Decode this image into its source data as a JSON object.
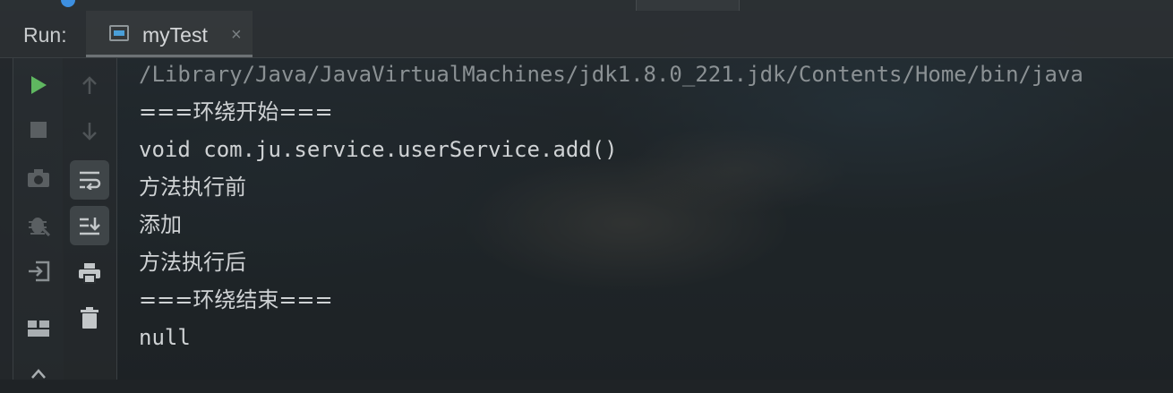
{
  "run_panel": {
    "label": "Run:",
    "tab": {
      "title": "myTest",
      "icon": "console-tab-icon",
      "close": "×"
    }
  },
  "toolbar": {
    "primary": [
      {
        "name": "rerun-icon",
        "color": "#5fb760"
      },
      {
        "name": "stop-icon",
        "color": "#5a5f62"
      },
      {
        "name": "camera-icon",
        "color": "#5a5f62"
      },
      {
        "name": "debug-bug-icon",
        "color": "#5a5f62"
      },
      {
        "name": "exit-icon",
        "color": "#8a9093"
      },
      {
        "name": "layout-icon",
        "color": "#a9aeb1"
      }
    ],
    "secondary": [
      {
        "name": "arrow-up-icon",
        "color": "#4f5457"
      },
      {
        "name": "arrow-down-icon",
        "color": "#4f5457"
      },
      {
        "name": "soft-wrap-icon",
        "color": "#c3c7c9",
        "active": true
      },
      {
        "name": "scroll-to-end-icon",
        "color": "#c3c7c9",
        "active": true
      },
      {
        "name": "print-icon",
        "color": "#c3c7c9"
      },
      {
        "name": "trash-icon",
        "color": "#c3c7c9"
      }
    ]
  },
  "console": {
    "lines": [
      "/Library/Java/JavaVirtualMachines/jdk1.8.0_221.jdk/Contents/Home/bin/java",
      "===环绕开始===",
      "void com.ju.service.userService.add()",
      "方法执行前",
      "添加",
      "方法执行后",
      "===环绕结束===",
      "null"
    ]
  }
}
